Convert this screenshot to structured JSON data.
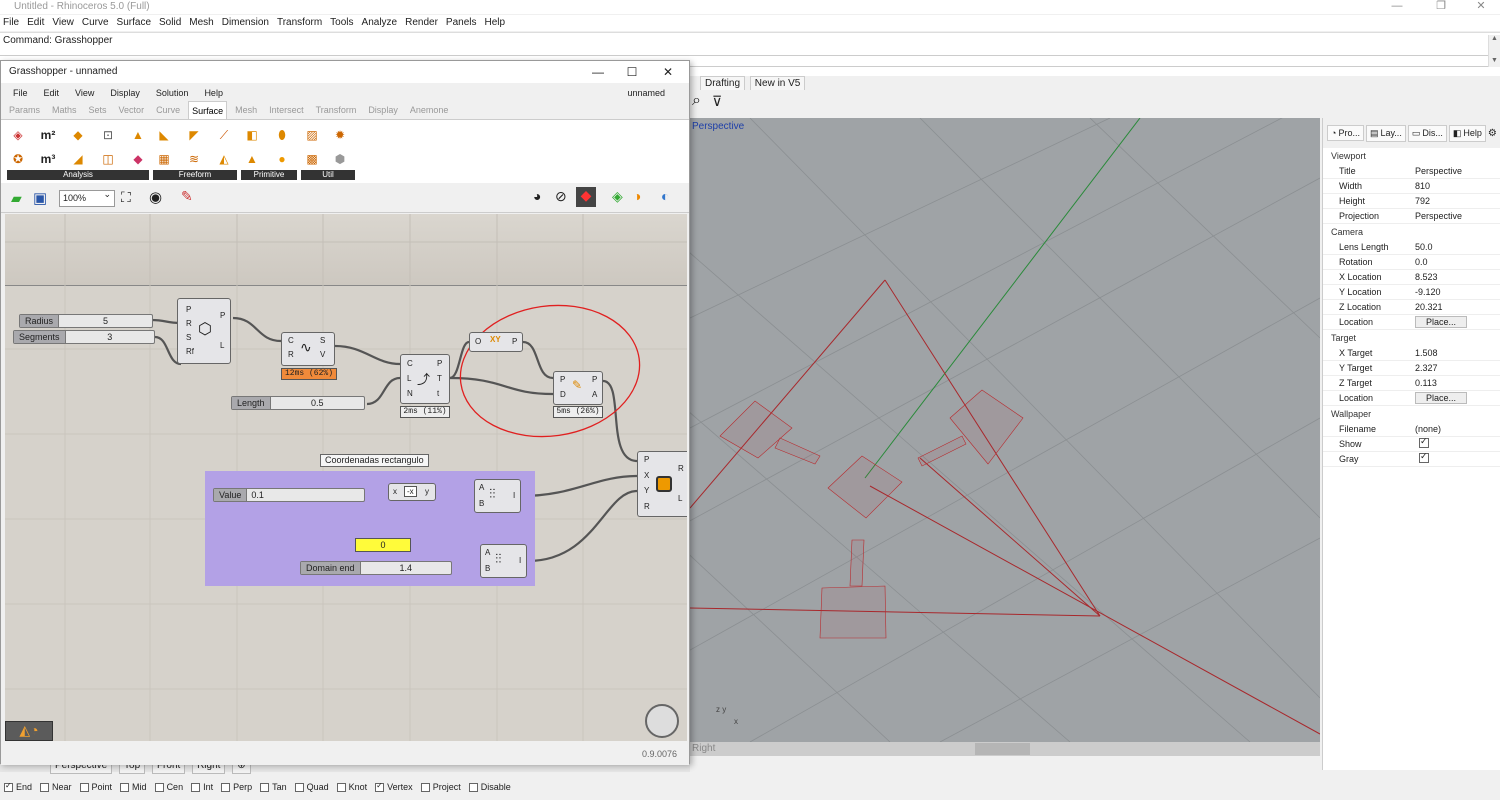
{
  "rhino": {
    "title": "Untitled - Rhinoceros 5.0 (Full)",
    "menu": [
      "File",
      "Edit",
      "View",
      "Curve",
      "Surface",
      "Solid",
      "Mesh",
      "Dimension",
      "Transform",
      "Tools",
      "Analyze",
      "Render",
      "Panels",
      "Help"
    ],
    "command": "Command: Grasshopper",
    "toolbar_tabs": [
      "Drafting",
      "New in V5"
    ],
    "viewport_label": "Perspective",
    "viewport2_label": "Right",
    "viewport_tabs": [
      "Perspective",
      "Top",
      "Front",
      "Right"
    ],
    "props_tabs": [
      "Pro...",
      "Lay...",
      "Dis...",
      "Help"
    ],
    "props": {
      "viewport_header": "Viewport",
      "title_k": "Title",
      "title_v": "Perspective",
      "width_k": "Width",
      "width_v": "810",
      "height_k": "Height",
      "height_v": "792",
      "projection_k": "Projection",
      "projection_v": "Perspective",
      "camera_header": "Camera",
      "lens_k": "Lens Length",
      "lens_v": "50.0",
      "rotation_k": "Rotation",
      "rotation_v": "0.0",
      "xloc_k": "X Location",
      "xloc_v": "8.523",
      "yloc_k": "Y Location",
      "yloc_v": "-9.120",
      "zloc_k": "Z Location",
      "zloc_v": "20.321",
      "location_k": "Location",
      "place": "Place...",
      "target_header": "Target",
      "xt_k": "X Target",
      "xt_v": "1.508",
      "yt_k": "Y Target",
      "yt_v": "2.327",
      "zt_k": "Z Target",
      "zt_v": "0.113",
      "tloc_k": "Location",
      "wallpaper_header": "Wallpaper",
      "filename_k": "Filename",
      "filename_v": "(none)",
      "show_k": "Show",
      "gray_k": "Gray"
    },
    "osnaps": [
      {
        "label": "End",
        "on": true
      },
      {
        "label": "Near",
        "on": false
      },
      {
        "label": "Point",
        "on": false
      },
      {
        "label": "Mid",
        "on": false
      },
      {
        "label": "Cen",
        "on": false
      },
      {
        "label": "Int",
        "on": false
      },
      {
        "label": "Perp",
        "on": false
      },
      {
        "label": "Tan",
        "on": false
      },
      {
        "label": "Quad",
        "on": false
      },
      {
        "label": "Knot",
        "on": false
      },
      {
        "label": "Vertex",
        "on": true
      },
      {
        "label": "Project",
        "on": false
      },
      {
        "label": "Disable",
        "on": false
      }
    ]
  },
  "gh": {
    "title": "Grasshopper - unnamed",
    "doc_name": "unnamed",
    "menu": [
      "File",
      "Edit",
      "View",
      "Display",
      "Solution",
      "Help"
    ],
    "tabs": [
      "Params",
      "Maths",
      "Sets",
      "Vector",
      "Curve",
      "Surface",
      "Mesh",
      "Intersect",
      "Transform",
      "Display",
      "Anemone"
    ],
    "active_tab": "Surface",
    "ribbon_groups": [
      "Analysis",
      "Freeform",
      "Primitive",
      "Util"
    ],
    "zoom": "100%",
    "version": "0.9.0076",
    "canvas": {
      "radius_label": "Radius",
      "radius_val": "5",
      "segments_label": "Segments",
      "segments_val": "3",
      "length_label": "Length",
      "length_val": "0.5",
      "value_label": "Value",
      "value_val": "0.1",
      "panel_val": "0",
      "domain_label": "Domain end",
      "domain_val": "1.4",
      "group_label": "Coordenadas rectangulo",
      "timer1": "12ms (62%)",
      "timer2": "2ms (11%)",
      "timer3": "5ms (26%)",
      "neg_label": "-x"
    }
  }
}
